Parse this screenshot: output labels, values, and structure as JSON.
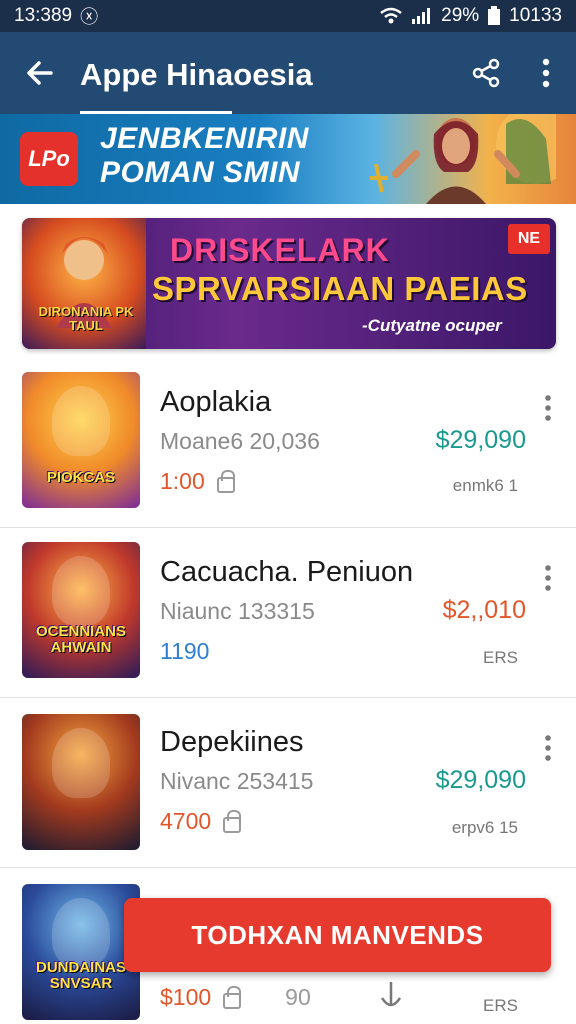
{
  "status_bar": {
    "time": "13:389",
    "battery": "29%",
    "clock_right": "10133"
  },
  "app_bar": {
    "title": "Appe Hinaoesia"
  },
  "promo": {
    "logo_text": "LPo",
    "line1": "JENBKENIRIN",
    "line2": "POMAN SMIN"
  },
  "banner": {
    "title": "DRISKELARK",
    "subtitle": "SPRVARSIAAN PAEIAS",
    "tagline": "-Cutyatne ocuper",
    "badge": "NE",
    "art_caption": "DIRONANIA PK TAUL"
  },
  "items": [
    {
      "title": "Aoplakia",
      "subtitle": "Moane6 20,036",
      "meta_value": "1:00",
      "meta_color": "#e2562b",
      "price": "$29,090",
      "price_color": "#1a9a8f",
      "note": "enmk6 1",
      "thumb_caption": "PIOKCAS"
    },
    {
      "title": "Cacuacha. Peniuon",
      "subtitle": "Niaunc 133315",
      "meta_value": "1190",
      "meta_color": "#2f7fd0",
      "price": "$2,,010",
      "price_color": "#e2562b",
      "note": "ERS",
      "thumb_caption": "OCENNIANS AHWAIN"
    },
    {
      "title": "Depekiines",
      "subtitle": "Nivanc 253415",
      "meta_value": "4700",
      "meta_color": "#e2562b",
      "price": "$29,090",
      "price_color": "#1a9a8f",
      "note": "erpv6 15",
      "thumb_caption": ""
    },
    {
      "title": "",
      "subtitle": "",
      "meta_value": "$100",
      "meta_color": "#e2562b",
      "meta_extra": "90",
      "price": "",
      "price_color": "#1a9a8f",
      "note": "ERS",
      "thumb_caption": "DUNDAINAS SNVSAR"
    }
  ],
  "cta": {
    "label": "TODHXAN MANVENDS"
  }
}
